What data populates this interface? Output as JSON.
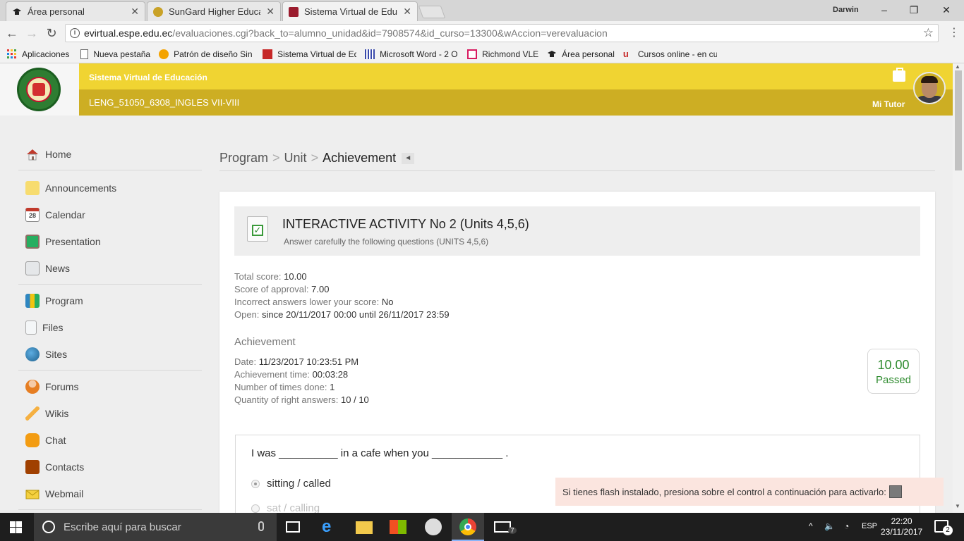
{
  "browser": {
    "tabs": [
      {
        "label": "Área personal",
        "close": "✕"
      },
      {
        "label": "SunGard Higher Educatio",
        "close": "✕"
      },
      {
        "label": "Sistema Virtual de Educa",
        "close": "✕"
      }
    ],
    "user": "Darwin",
    "url_host": "evirtual.espe.edu.ec",
    "url_path": "/evaluaciones.cgi?back_to=alumno_unidad&id=7908574&id_curso=13300&wAccion=verevaluacion",
    "bookmarks": [
      {
        "label": "Aplicaciones",
        "icon": "apps-grid-icon",
        "color": "#e53935"
      },
      {
        "label": "Nueva pestaña",
        "icon": "page-icon",
        "color": "#ffffff"
      },
      {
        "label": "Patrón de diseño Sin",
        "icon": "gear-icon",
        "color": "#f4a300"
      },
      {
        "label": "Sistema Virtual de Ed",
        "icon": "book-icon",
        "color": "#c62828"
      },
      {
        "label": "Microsoft Word - 2 O",
        "icon": "pillars-icon",
        "color": "#3949ab"
      },
      {
        "label": "Richmond VLE",
        "icon": "richmond-icon",
        "color": "#d81b60"
      },
      {
        "label": "Área personal",
        "icon": "grad-cap-icon",
        "color": "#222222"
      },
      {
        "label": "Cursos online - en cu",
        "icon": "u-logo-icon",
        "color": "#c62828"
      }
    ]
  },
  "header": {
    "system_name": "Sistema Virtual de Educación",
    "course": "LENG_51050_6308_INGLES VII-VIII",
    "tutor_label": "Mi Tutor",
    "band_color": "#f0d432",
    "band_dark_color": "#cdae23"
  },
  "sidebar": {
    "groups": [
      [
        {
          "label": "Home",
          "icon": "home-icon",
          "color": "#c0392b"
        }
      ],
      [
        {
          "label": "Announcements",
          "icon": "notes-icon",
          "color": "#f7dc6f"
        },
        {
          "label": "Calendar",
          "icon": "calendar-icon",
          "color": "#7f8c8d"
        },
        {
          "label": "Presentation",
          "icon": "board-icon",
          "color": "#27ae60"
        },
        {
          "label": "News",
          "icon": "newspaper-icon",
          "color": "#bdc3c7"
        }
      ],
      [
        {
          "label": "Program",
          "icon": "binders-icon",
          "color": "#2e86c1"
        },
        {
          "label": "Files",
          "icon": "file-icon",
          "color": "#d5d8dc"
        },
        {
          "label": "Sites",
          "icon": "globe-icon",
          "color": "#229954"
        }
      ],
      [
        {
          "label": "Forums",
          "icon": "people-icon",
          "color": "#e67e22"
        },
        {
          "label": "Wikis",
          "icon": "pencil-icon",
          "color": "#f5b041"
        },
        {
          "label": "Chat",
          "icon": "chat-icon",
          "color": "#f39c12"
        },
        {
          "label": "Contacts",
          "icon": "address-book-icon",
          "color": "#a04000"
        },
        {
          "label": "Webmail",
          "icon": "envelope-icon",
          "color": "#f4d03f"
        }
      ]
    ]
  },
  "breadcrumb": {
    "program": "Program",
    "unit": "Unit",
    "current": "Achievement",
    "separator": ">",
    "back": "◄"
  },
  "activity": {
    "title": "INTERACTIVE ACTIVITY No 2 (Units 4,5,6)",
    "subtitle": "Answer carefully the following questions (UNITS 4,5,6)",
    "details": [
      {
        "label": "Total score:",
        "value": "10.00"
      },
      {
        "label": "Score of approval:",
        "value": "7.00"
      },
      {
        "label": "Incorrect answers lower your score:",
        "value": "No"
      },
      {
        "label": "Open:",
        "value": "since 20/11/2017 00:00 until 26/11/2017 23:59"
      }
    ]
  },
  "achievement": {
    "title": "Achievement",
    "details": [
      {
        "label": "Date:",
        "value": "11/23/2017 10:23:51 PM"
      },
      {
        "label": "Achievement time:",
        "value": "00:03:28"
      },
      {
        "label": "Number of times done:",
        "value": "1"
      },
      {
        "label": "Quantity of right answers:",
        "value": "10 / 10"
      }
    ],
    "score": "10.00",
    "status": "Passed",
    "status_color": "#2e8b2e"
  },
  "question": {
    "text": "I was __________  in a cafe when you ____________  .",
    "options": [
      {
        "label": "sitting / called",
        "selected": true
      },
      {
        "label": "sat / calling",
        "selected": false
      }
    ]
  },
  "flash_notice": "Si tienes flash instalado, presiona sobre el control a continuación para activarlo:",
  "taskbar": {
    "search_placeholder": "Escribe aquí para buscar",
    "language": "ESP",
    "time": "22:20",
    "date": "23/11/2017",
    "notifications": "2",
    "mail_badge": "7"
  }
}
